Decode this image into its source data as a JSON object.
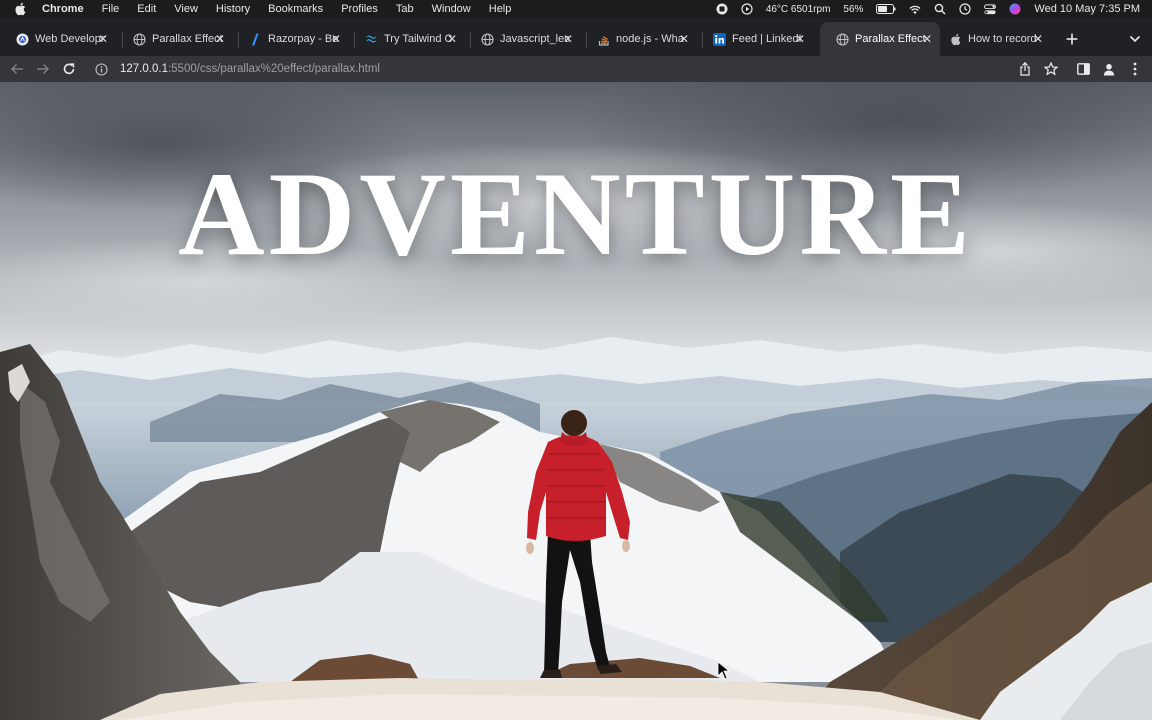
{
  "menubar": {
    "app_name": "Chrome",
    "menus": [
      "File",
      "Edit",
      "View",
      "History",
      "Bookmarks",
      "Profiles",
      "Tab",
      "Window",
      "Help"
    ],
    "cpu_stat": "46°C 6501rpm",
    "battery": "56%",
    "datetime": "Wed 10 May  7:35 PM"
  },
  "tabs": [
    {
      "title": "Web Developm",
      "icon": "web-dev-favicon"
    },
    {
      "title": "Parallax Effect",
      "icon": "globe-icon"
    },
    {
      "title": "Razorpay - Be",
      "icon": "razorpay-favicon"
    },
    {
      "title": "Try Tailwind C",
      "icon": "tailwind-favicon"
    },
    {
      "title": "Javascript_lec",
      "icon": "globe-icon"
    },
    {
      "title": "node.js - Wha",
      "icon": "stackoverflow-favicon"
    },
    {
      "title": "Feed | LinkedI",
      "icon": "linkedin-favicon"
    },
    {
      "title": "Parallax Effect",
      "icon": "globe-icon",
      "active": true
    },
    {
      "title": "How to record",
      "icon": "apple-favicon"
    }
  ],
  "toolbar": {
    "url_host": "127.0.0.1",
    "url_rest": ":5500/css/parallax%20effect/parallax.html"
  },
  "hero": {
    "title": "ADVENTURE"
  },
  "colors": {
    "chrome_dark": "#202124",
    "chrome_toolbar": "#35363a",
    "jacket_red": "#c8202a"
  }
}
